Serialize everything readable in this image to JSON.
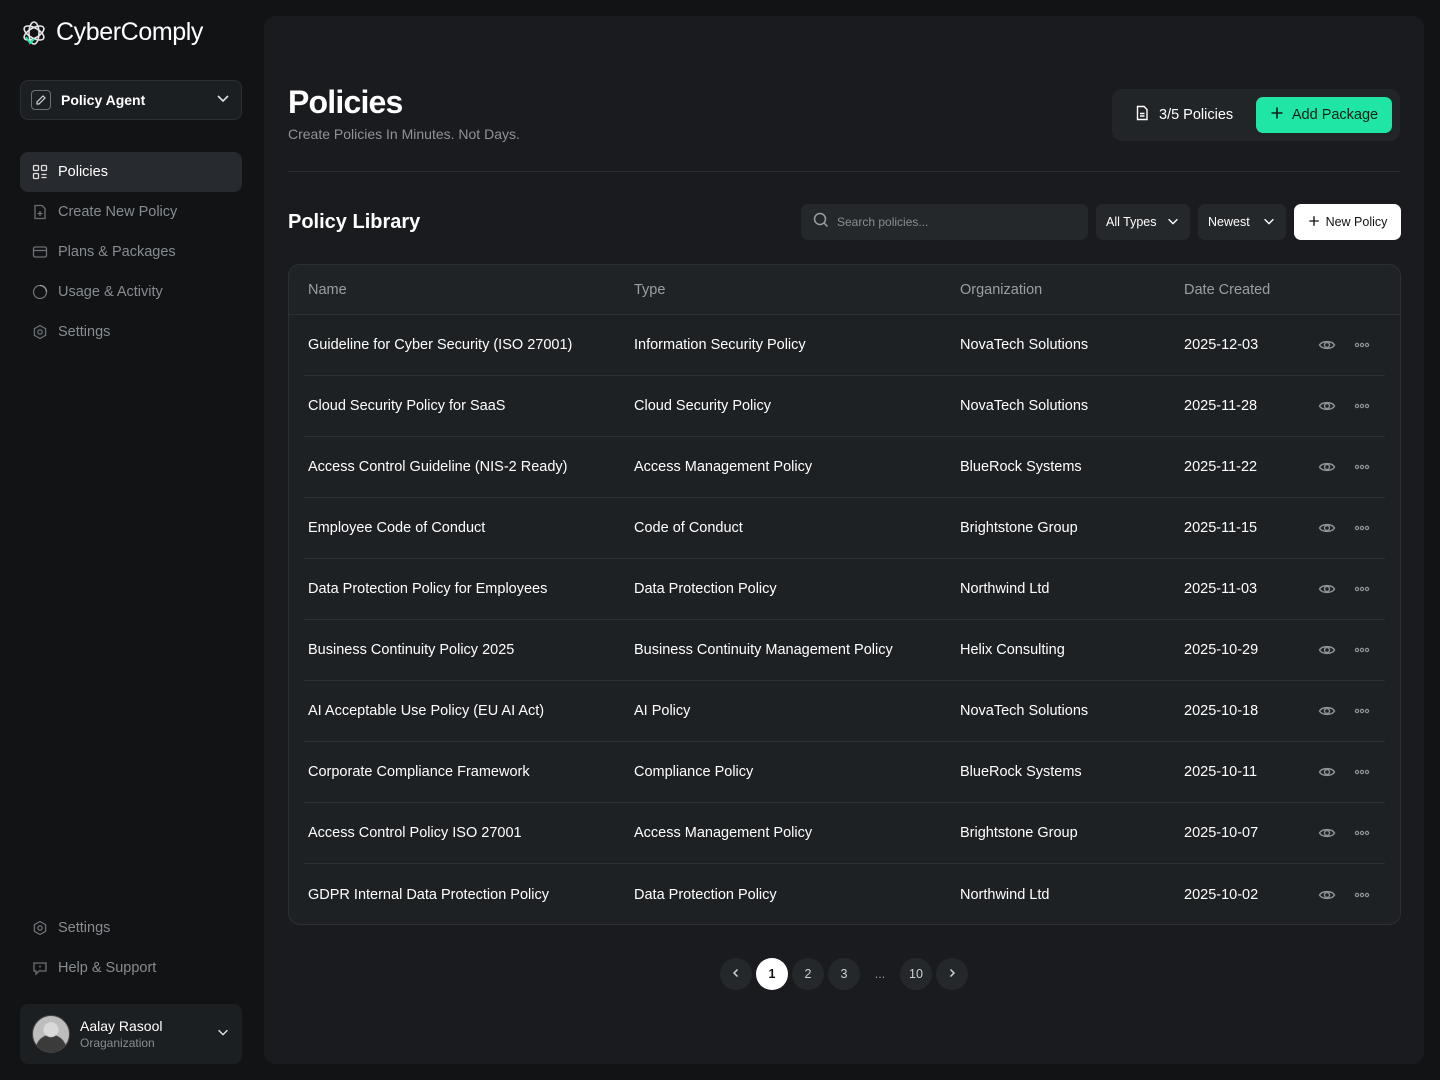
{
  "brand": {
    "name": "CyberComply"
  },
  "agent": {
    "label": "Policy Agent"
  },
  "nav": {
    "items": [
      {
        "label": "Policies",
        "icon": "grid-icon",
        "active": true
      },
      {
        "label": "Create New Policy",
        "icon": "file-plus-icon",
        "active": false
      },
      {
        "label": "Plans & Packages",
        "icon": "card-icon",
        "active": false
      },
      {
        "label": "Usage & Activity",
        "icon": "activity-icon",
        "active": false
      },
      {
        "label": "Settings",
        "icon": "gear-icon",
        "active": false
      }
    ],
    "bottom": [
      {
        "label": "Settings",
        "icon": "gear-icon"
      },
      {
        "label": "Help & Support",
        "icon": "help-chat-icon"
      }
    ]
  },
  "user": {
    "name": "Aalay Rasool",
    "org": "Oraganization"
  },
  "header": {
    "title": "Policies",
    "subtitle": "Create Policies In Minutes. Not Days.",
    "quota": "3/5 Policies",
    "add_package": "Add Package"
  },
  "library": {
    "title": "Policy Library",
    "search_placeholder": "Search policies...",
    "filter_type": "All Types",
    "sort": "Newest",
    "new_policy": "New Policy",
    "columns": [
      "Name",
      "Type",
      "Organization",
      "Date Created"
    ],
    "rows": [
      {
        "name": "Guideline for Cyber Security (ISO 27001)",
        "type": "Information Security Policy",
        "org": "NovaTech Solutions",
        "date": "2025-12-03"
      },
      {
        "name": "Cloud Security Policy for SaaS",
        "type": "Cloud Security Policy",
        "org": "NovaTech Solutions",
        "date": "2025-11-28"
      },
      {
        "name": "Access Control Guideline (NIS-2 Ready)",
        "type": "Access Management Policy",
        "org": "BlueRock Systems",
        "date": "2025-11-22"
      },
      {
        "name": "Employee Code of Conduct",
        "type": "Code of Conduct",
        "org": "Brightstone Group",
        "date": "2025-11-15"
      },
      {
        "name": "Data Protection Policy for Employees",
        "type": "Data Protection Policy",
        "org": "Northwind Ltd",
        "date": "2025-11-03"
      },
      {
        "name": "Business Continuity Policy 2025",
        "type": "Business Continuity Management Policy",
        "org": "Helix Consulting",
        "date": "2025-10-29"
      },
      {
        "name": "AI Acceptable Use Policy (EU AI Act)",
        "type": "AI Policy",
        "org": "NovaTech Solutions",
        "date": "2025-10-18"
      },
      {
        "name": "Corporate Compliance Framework",
        "type": "Compliance Policy",
        "org": "BlueRock Systems",
        "date": "2025-10-11"
      },
      {
        "name": "Access Control Policy ISO 27001",
        "type": "Access Management Policy",
        "org": "Brightstone Group",
        "date": "2025-10-07"
      },
      {
        "name": "GDPR Internal Data Protection Policy",
        "type": "Data Protection Policy",
        "org": "Northwind Ltd",
        "date": "2025-10-02"
      }
    ]
  },
  "pagination": {
    "pages": [
      "1",
      "2",
      "3",
      "...",
      "10"
    ],
    "current": "1"
  },
  "colors": {
    "accent": "#1fe6a4",
    "background": "#111315",
    "panel": "#191b1e"
  }
}
